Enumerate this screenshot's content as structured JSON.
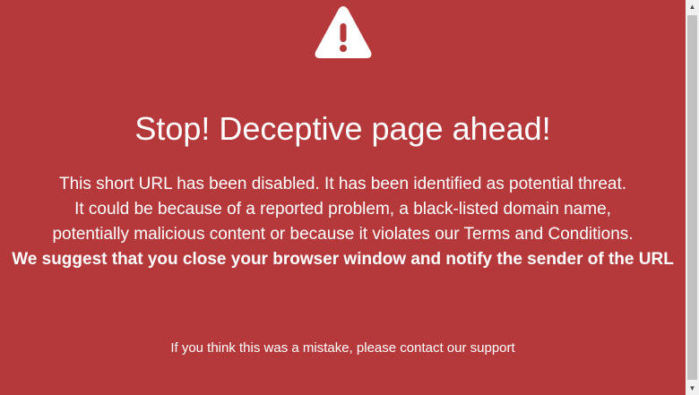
{
  "page": {
    "title": "Stop! Deceptive page ahead!",
    "message_lines": [
      "This short URL has been disabled. It has been identified as potential threat.",
      "It could be because of a reported problem, a black-listed domain name,",
      "potentially malicious content or because it violates our Terms and Conditions."
    ],
    "warning": "We suggest that you close your browser window and notify the sender of the URL",
    "support_text": "If you think this was a mistake, please contact our support"
  },
  "icons": {
    "warning": "warning-triangle-icon"
  },
  "colors": {
    "background": "#b5393b",
    "text": "#ffffff"
  }
}
